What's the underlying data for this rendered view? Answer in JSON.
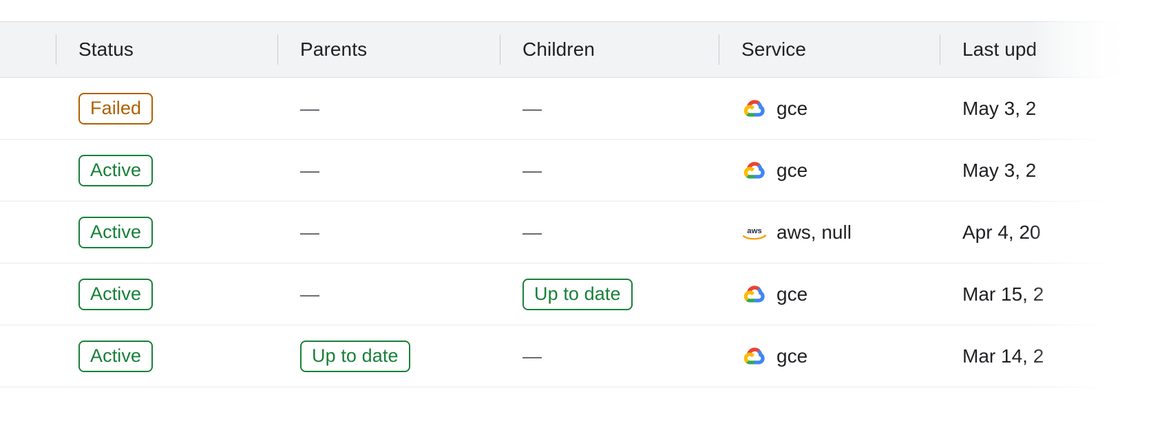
{
  "table": {
    "columns": [
      {
        "key": "checkbox",
        "label": "",
        "align": "left"
      },
      {
        "key": "status",
        "label": "Status",
        "align": "left"
      },
      {
        "key": "parents",
        "label": "Parents",
        "align": "left"
      },
      {
        "key": "children",
        "label": "Children",
        "align": "left"
      },
      {
        "key": "service",
        "label": "Service",
        "align": "left"
      },
      {
        "key": "last_updated",
        "label": "Last upd",
        "align": "left"
      }
    ],
    "empty_value": "—",
    "rows": [
      {
        "status": "Failed",
        "status_kind": "failed",
        "parents": "—",
        "children": "—",
        "service_icon": "google-cloud-icon",
        "service": "gce",
        "last_updated": "May 3, 2"
      },
      {
        "status": "Active",
        "status_kind": "active",
        "parents": "—",
        "children": "—",
        "service_icon": "google-cloud-icon",
        "service": "gce",
        "last_updated": "May 3, 2"
      },
      {
        "status": "Active",
        "status_kind": "active",
        "parents": "—",
        "children": "—",
        "service_icon": "aws-icon",
        "service": "aws, null",
        "last_updated": "Apr 4, 20"
      },
      {
        "status": "Active",
        "status_kind": "active",
        "parents": "—",
        "children": "Up to date",
        "service_icon": "google-cloud-icon",
        "service": "gce",
        "last_updated": "Mar 15, 2"
      },
      {
        "status": "Active",
        "status_kind": "active",
        "parents": "Up to date",
        "children": "—",
        "service_icon": "google-cloud-icon",
        "service": "gce",
        "last_updated": "Mar 14, 2"
      }
    ]
  },
  "colors": {
    "status_active": "#188038",
    "status_failed": "#b06000",
    "chip_uptodate": "#188038",
    "header_bg": "#f1f3f4",
    "text_primary": "#202124",
    "text_secondary": "#5f6368",
    "row_border": "#e8eaed"
  }
}
